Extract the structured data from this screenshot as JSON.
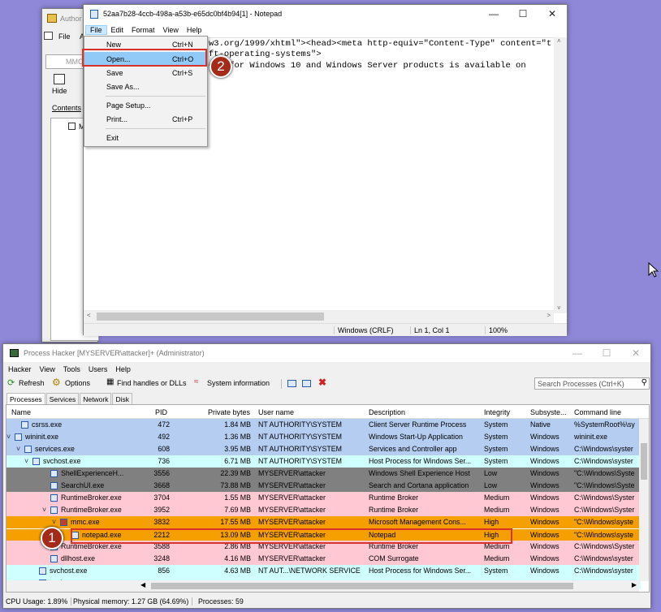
{
  "bg_window": {
    "title_fragment": "Author",
    "menu_file": "File",
    "menu_a": "A",
    "mmc_tab": "MMC",
    "hide_label": "Hide",
    "contents_tab": "Contents",
    "tree_item": "M"
  },
  "notepad": {
    "title": "52aa7b28-4ccb-498a-a53b-e65dc0bf4b94[1] - Notepad",
    "menu": [
      "File",
      "Edit",
      "Format",
      "View",
      "Help"
    ],
    "lines": [
      "w3.org/1999/xhtml\"><head><meta http-equiv=\"Content-Type\" content=\"t",
      "ft-operating-systems\">",
      "elp for Windows 10 and Windows Server products is available on"
    ],
    "status": {
      "eol": "Windows (CRLF)",
      "pos": "Ln 1, Col 1",
      "zoom": "100%"
    },
    "file_menu": [
      {
        "label": "New",
        "shortcut": "Ctrl+N"
      },
      {
        "label": "Open...",
        "shortcut": "Ctrl+O"
      },
      {
        "label": "Save",
        "shortcut": "Ctrl+S"
      },
      {
        "label": "Save As...",
        "shortcut": ""
      },
      {
        "label": "Page Setup...",
        "shortcut": ""
      },
      {
        "label": "Print...",
        "shortcut": "Ctrl+P"
      },
      {
        "label": "Exit",
        "shortcut": ""
      }
    ]
  },
  "badges": [
    "1",
    "2"
  ],
  "ph": {
    "title": "Process Hacker [MYSERVER\\attacker]+ (Administrator)",
    "menu": [
      "Hacker",
      "View",
      "Tools",
      "Users",
      "Help"
    ],
    "toolbar": {
      "refresh": "Refresh",
      "options": "Options",
      "find": "Find handles or DLLs",
      "sysinfo": "System information"
    },
    "search_placeholder": "Search Processes (Ctrl+K)",
    "tabs": [
      "Processes",
      "Services",
      "Network",
      "Disk"
    ],
    "columns": [
      "Name",
      "PID",
      "Private bytes",
      "User name",
      "Description",
      "Integrity",
      "Subsyste...",
      "Command line"
    ],
    "rows": [
      {
        "name": "csrss.exe",
        "pid": "472",
        "priv": "1.84 MB",
        "user": "NT AUTHORITY\\SYSTEM",
        "desc": "Client Server Runtime Process",
        "integ": "System",
        "sub": "Native",
        "cmd": "%SystemRoot%\\sy",
        "color": "#b4cdf0"
      },
      {
        "name": "wininit.exe",
        "pid": "492",
        "priv": "1.36 MB",
        "user": "NT AUTHORITY\\SYSTEM",
        "desc": "Windows Start-Up Application",
        "integ": "System",
        "sub": "Windows",
        "cmd": "wininit.exe",
        "color": "#b4cdf0"
      },
      {
        "name": "services.exe",
        "pid": "608",
        "priv": "3.95 MB",
        "user": "NT AUTHORITY\\SYSTEM",
        "desc": "Services and Controller app",
        "integ": "System",
        "sub": "Windows",
        "cmd": "C:\\Windows\\syster",
        "color": "#b4cdf0"
      },
      {
        "name": "svchost.exe",
        "pid": "736",
        "priv": "6.71 MB",
        "user": "NT AUTHORITY\\SYSTEM",
        "desc": "Host Process for Windows Ser...",
        "integ": "System",
        "sub": "Windows",
        "cmd": "C:\\Windows\\syster",
        "color": "#d0ffff"
      },
      {
        "name": "ShellExperienceH...",
        "pid": "3556",
        "priv": "22.39 MB",
        "user": "MYSERVER\\attacker",
        "desc": "Windows Shell Experience Host",
        "integ": "Low",
        "sub": "Windows",
        "cmd": "\"C:\\Windows\\Syste",
        "color": "#808080"
      },
      {
        "name": "SearchUI.exe",
        "pid": "3668",
        "priv": "73.88 MB",
        "user": "MYSERVER\\attacker",
        "desc": "Search and Cortana application",
        "integ": "Low",
        "sub": "Windows",
        "cmd": "\"C:\\Windows\\Syste",
        "color": "#808080"
      },
      {
        "name": "RuntimeBroker.exe",
        "pid": "3704",
        "priv": "1.55 MB",
        "user": "MYSERVER\\attacker",
        "desc": "Runtime Broker",
        "integ": "Medium",
        "sub": "Windows",
        "cmd": "C:\\Windows\\Syster",
        "color": "#ffc8d2"
      },
      {
        "name": "RuntimeBroker.exe",
        "pid": "3952",
        "priv": "7.69 MB",
        "user": "MYSERVER\\attacker",
        "desc": "Runtime Broker",
        "integ": "Medium",
        "sub": "Windows",
        "cmd": "C:\\Windows\\Syster",
        "color": "#ffc8d2"
      },
      {
        "name": "mmc.exe",
        "pid": "3832",
        "priv": "17.55 MB",
        "user": "MYSERVER\\attacker",
        "desc": "Microsoft Management Cons...",
        "integ": "High",
        "sub": "Windows",
        "cmd": "\"C:\\Windows\\syste",
        "color": "#f5a000"
      },
      {
        "name": "notepad.exe",
        "pid": "2212",
        "priv": "13.09 MB",
        "user": "MYSERVER\\attacker",
        "desc": "Notepad",
        "integ": "High",
        "sub": "Windows",
        "cmd": "\"C:\\Windows\\syste",
        "color": "#f5a000"
      },
      {
        "name": "RuntimeBroker.exe",
        "pid": "3588",
        "priv": "2.86 MB",
        "user": "MYSERVER\\attacker",
        "desc": "Runtime Broker",
        "integ": "Medium",
        "sub": "Windows",
        "cmd": "C:\\Windows\\Syster",
        "color": "#ffc8d2"
      },
      {
        "name": "dllhost.exe",
        "pid": "3248",
        "priv": "4.16 MB",
        "user": "MYSERVER\\attacker",
        "desc": "COM Surrogate",
        "integ": "Medium",
        "sub": "Windows",
        "cmd": "C:\\Windows\\syster",
        "color": "#ffc8d2"
      },
      {
        "name": "svchost.exe",
        "pid": "856",
        "priv": "4.63 MB",
        "user": "NT AUT...\\NETWORK SERVICE",
        "desc": "Host Process for Windows Ser...",
        "integ": "System",
        "sub": "Windows",
        "cmd": "C:\\Windows\\syster",
        "color": "#d0ffff"
      },
      {
        "name": "svchost.exe",
        "pid": "",
        "priv": "",
        "user": "",
        "desc": "",
        "integ": "",
        "sub": "",
        "cmd": "",
        "color": "#d0ffff"
      }
    ],
    "status": {
      "cpu": "CPU Usage: 1.89%",
      "mem": "Physical memory: 1.27 GB (64.69%)",
      "procs": "Processes: 59"
    }
  }
}
